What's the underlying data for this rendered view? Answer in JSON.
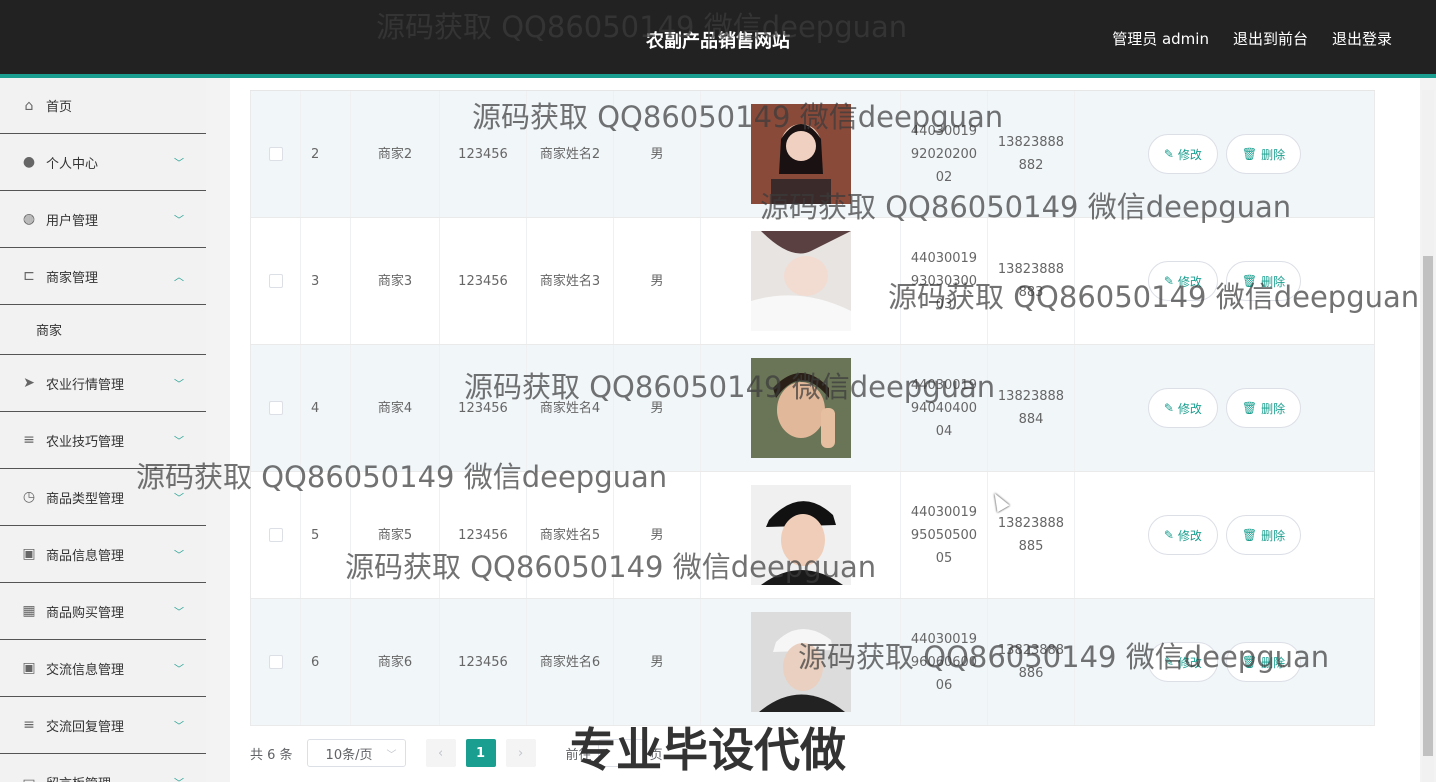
{
  "header": {
    "title": "农副产品销售网站",
    "admin": "管理员 admin",
    "to_front": "退出到前台",
    "logout": "退出登录"
  },
  "sidebar": {
    "items": [
      {
        "label": "首页",
        "icon": "home-icon",
        "expandable": false
      },
      {
        "label": "个人中心",
        "icon": "user-icon",
        "expandable": true
      },
      {
        "label": "用户管理",
        "icon": "globe-icon",
        "expandable": true
      },
      {
        "label": "商家管理",
        "icon": "crop-icon",
        "expandable": true,
        "expanded": true
      },
      {
        "label": "农业行情管理",
        "icon": "send-icon",
        "expandable": true
      },
      {
        "label": "农业技巧管理",
        "icon": "list-icon",
        "expandable": true
      },
      {
        "label": "商品类型管理",
        "icon": "clock-icon",
        "expandable": true
      },
      {
        "label": "商品信息管理",
        "icon": "clipboard-icon",
        "expandable": true
      },
      {
        "label": "商品购买管理",
        "icon": "grid-icon",
        "expandable": true
      },
      {
        "label": "交流信息管理",
        "icon": "clipboard-check-icon",
        "expandable": true
      },
      {
        "label": "交流回复管理",
        "icon": "list-icon",
        "expandable": true
      },
      {
        "label": "留言板管理",
        "icon": "message-icon",
        "expandable": true
      }
    ],
    "sub_item": "商家"
  },
  "table": {
    "rows": [
      {
        "idx": "2",
        "account": "商家2",
        "password": "123456",
        "name": "商家姓名2",
        "sex": "男",
        "id_card": [
          "44030019",
          "92020200",
          "02"
        ],
        "phone": [
          "13823888",
          "882"
        ],
        "avatar_color": "#8a4a3a"
      },
      {
        "idx": "3",
        "account": "商家3",
        "password": "123456",
        "name": "商家姓名3",
        "sex": "男",
        "id_card": [
          "44030019",
          "93030300",
          "03"
        ],
        "phone": [
          "13823888",
          "883"
        ],
        "avatar_color": "#d9c8c2"
      },
      {
        "idx": "4",
        "account": "商家4",
        "password": "123456",
        "name": "商家姓名4",
        "sex": "男",
        "id_card": [
          "44030019",
          "94040400",
          "04"
        ],
        "phone": [
          "13823888",
          "884"
        ],
        "avatar_color": "#5d6a4a"
      },
      {
        "idx": "5",
        "account": "商家5",
        "password": "123456",
        "name": "商家姓名5",
        "sex": "男",
        "id_card": [
          "44030019",
          "95050500",
          "05"
        ],
        "phone": [
          "13823888",
          "885"
        ],
        "avatar_color": "#2a2a2a"
      },
      {
        "idx": "6",
        "account": "商家6",
        "password": "123456",
        "name": "商家姓名6",
        "sex": "男",
        "id_card": [
          "44030019",
          "96060600",
          "06"
        ],
        "phone": [
          "13823888",
          "886"
        ],
        "avatar_color": "#3a3a3a"
      }
    ],
    "edit_label": "修改",
    "delete_label": "删除"
  },
  "pagination": {
    "total": "共 6 条",
    "page_size": "10条/页",
    "current": "1",
    "goto_prefix": "前往",
    "goto_suffix": "页"
  },
  "watermark": {
    "text": "源码获取 QQ86050149 微信deepguan",
    "big": "专业毕设代做"
  }
}
